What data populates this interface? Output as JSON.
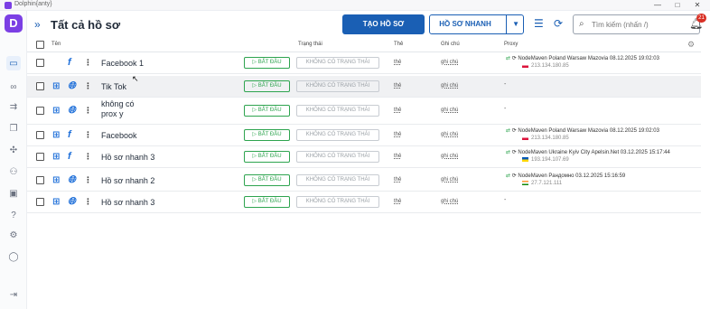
{
  "window": {
    "title": "Dolphin{anty}",
    "minimize": "—",
    "maximize": "□",
    "close": "✕"
  },
  "header": {
    "title": "Tất cả hồ sơ",
    "create_label": "TẠO HỒ SƠ",
    "quick_label": "HỒ SƠ NHANH",
    "search_placeholder": "Tìm kiếm (nhấn /)",
    "notifications": "21"
  },
  "columns": {
    "name": "Tên",
    "status": "Trạng thái",
    "tag": "Thẻ",
    "note": "Ghi chú",
    "proxy": "Proxy"
  },
  "rows": [
    {
      "os": "apple",
      "app": "f",
      "name": "Facebook 1",
      "start": "▷ BẮT ĐẦU",
      "status": "KHÔNG CÓ TRẠNG THÁI",
      "tag": "thẻ",
      "note": "ghi chú",
      "proxy": {
        "line1": "NodeMaven Poland Warsaw Mazovia 08.12.2025 19:02:03",
        "ip": "213.134.180.85",
        "flag": "pl"
      }
    },
    {
      "os": "windows",
      "app": "globe",
      "name": "Tik Tok",
      "start": "▷ BẮT ĐẦU",
      "status": "KHÔNG CÓ TRẠNG THÁI",
      "tag": "thẻ",
      "note": "ghi chú",
      "proxy": {
        "dash": "-"
      }
    },
    {
      "os": "windows",
      "app": "globe",
      "name": "không có prox y",
      "start": "▷ BẮT ĐẦU",
      "status": "KHÔNG CÓ TRẠNG THÁI",
      "tag": "thẻ",
      "note": "ghi chú",
      "proxy": {
        "dash": "-"
      }
    },
    {
      "os": "windows",
      "app": "f",
      "name": "Facebook",
      "start": "▷ BẮT ĐẦU",
      "status": "KHÔNG CÓ TRẠNG THÁI",
      "tag": "thẻ",
      "note": "ghi chú",
      "proxy": {
        "line1": "NodeMaven Poland Warsaw Mazovia 08.12.2025 19:02:03",
        "ip": "213.134.180.85",
        "flag": "pl"
      }
    },
    {
      "os": "windows",
      "app": "f",
      "name": "Hồ sơ nhanh 3",
      "start": "▷ BẮT ĐẦU",
      "status": "KHÔNG CÓ TRẠNG THÁI",
      "tag": "thẻ",
      "note": "ghi chú",
      "proxy": {
        "line1": "NodeMaven Ukraine Kyiv City Apelsin.Net 03.12.2025 15:17:44",
        "ip": "193.194.107.69",
        "flag": "ua"
      }
    },
    {
      "os": "windows",
      "app": "globe",
      "name": "Hồ sơ nhanh 2",
      "start": "▷ BẮT ĐẦU",
      "status": "KHÔNG CÓ TRẠNG THÁI",
      "tag": "thẻ",
      "note": "ghi chú",
      "proxy": {
        "line1": "NodeMaven Рандомно 03.12.2025 15:16:59",
        "ip": "27.7.121.111",
        "flag": "in"
      }
    },
    {
      "os": "windows",
      "app": "globe",
      "name": "Hồ sơ nhanh 3",
      "start": "▷ BẮT ĐẦU",
      "status": "KHÔNG CÓ TRẠNG THÁI",
      "tag": "thẻ",
      "note": "ghi chú",
      "proxy": {
        "dash": "-"
      }
    }
  ],
  "icons": {
    "menu": "⋮",
    "sort": "⇅",
    "refresh": "⟳",
    "collapse": "»"
  },
  "colors": {
    "primary": "#1a5fb4",
    "start": "#2ea44f",
    "brand": "#7b3fe4",
    "badge": "#d93025"
  }
}
